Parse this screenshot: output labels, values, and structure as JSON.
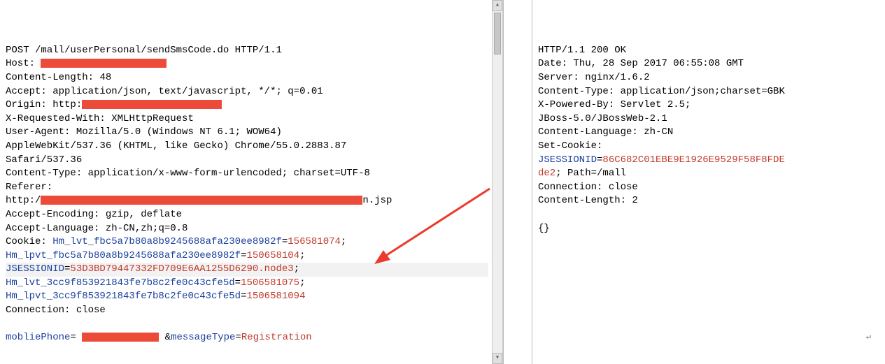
{
  "request": {
    "method": "POST",
    "path": "/mall/userPersonal/sendSmsCode.do",
    "protocol": "HTTP/1.1",
    "host_label": "Host:",
    "content_length_label": "Content-Length:",
    "content_length_value": "48",
    "accept_label": "Accept:",
    "accept_value": "application/json, text/javascript, */*; q=0.01",
    "origin_label": "Origin:",
    "origin_prefix": "http:",
    "xrw_label": "X-Requested-With:",
    "xrw_value": "XMLHttpRequest",
    "ua_label": "User-Agent:",
    "ua_value": "Mozilla/5.0 (Windows NT 6.1; WOW64)",
    "ua_line2": "AppleWebKit/537.36 (KHTML, like Gecko) Chrome/55.0.2883.87",
    "ua_line3": "Safari/537.36",
    "ctype_label": "Content-Type:",
    "ctype_value": "application/x-www-form-urlencoded; charset=UTF-8",
    "referer_label": "Referer:",
    "referer_prefix": "http:/",
    "referer_suffix": "n.jsp",
    "accenc_label": "Accept-Encoding:",
    "accenc_value": "gzip, deflate",
    "acclang_label": "Accept-Language:",
    "acclang_value": "zh-CN,zh;q=0.8",
    "cookie_label": "Cookie:",
    "ck1_name": "Hm_lvt_fbc5a7b80a8b9245688afa230ee8982f",
    "ck1_val_a": "15",
    "ck1_val_b": "6581074",
    "ck2_name": "Hm_lpvt_fbc5a7b80a8b9245688afa230ee8982f",
    "ck2_val_a": "15065810",
    "ck2_val_b": "4",
    "ck3_name": "JSESSIONID",
    "ck3_val": "53D3BD79447332FD709E6AA1255D6290.node3",
    "ck4_name": "Hm_lvt_3cc9f853921843fe7b8c2fe0c43cfe5d",
    "ck4_val": "1506581075",
    "ck5_name": "Hm_lpvt_3cc9f853921843fe7b8c2fe0c43cfe5d",
    "ck5_val": "1506581094",
    "conn_label": "Connection:",
    "conn_value": "close",
    "body_p1_key": "mobliePhone",
    "body_amp": "&",
    "body_p2_key": "messageType",
    "body_p2_val": "Registration"
  },
  "response": {
    "status_line": "HTTP/1.1 200 OK",
    "date_label": "Date:",
    "date_value": "Thu, 28 Sep 2017 06:55:08 GMT",
    "server_label": "Server:",
    "server_value": "nginx/1.6.2",
    "ctype_label": "Content-Type:",
    "ctype_value": "application/json;charset=GBK",
    "xpow_label": "X-Powered-By:",
    "xpow_value": "Servlet 2.5;",
    "xpow_line2": "JBoss-5.0/JBossWeb-2.1",
    "clang_label": "Content-Language:",
    "clang_value": "zh-CN",
    "setck_label": "Set-Cookie:",
    "jsid_name": "JSESSIONID",
    "jsid_val": "86C682C01EBE9E1926E9529F58F8FDE",
    "jsid_trail": "de2",
    "jsid_path_label": "; Path=",
    "jsid_path_val": "/mall",
    "conn_label": "Connection:",
    "conn_value": "close",
    "clen_label": "Content-Length:",
    "clen_value": "2",
    "body": "{}"
  }
}
